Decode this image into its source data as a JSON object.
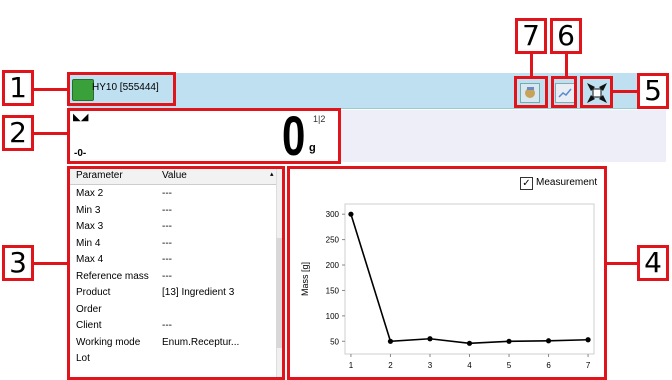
{
  "title_bar": {
    "app_title": "HY10 [555444]"
  },
  "display": {
    "value": "0",
    "unit": "g",
    "stability_marker": "◣◢",
    "zero_marker": "-0-",
    "range_indicator": "1|2"
  },
  "callouts": [
    "1",
    "2",
    "3",
    "4",
    "5",
    "6",
    "7"
  ],
  "table": {
    "headers": [
      "Parameter",
      "Value"
    ],
    "rows": [
      {
        "p": "Max 2",
        "v": "---"
      },
      {
        "p": "Min 3",
        "v": "---"
      },
      {
        "p": "Max 3",
        "v": "---"
      },
      {
        "p": "Min 4",
        "v": "---"
      },
      {
        "p": "Max 4",
        "v": "---"
      },
      {
        "p": "Reference mass",
        "v": "---"
      },
      {
        "p": "Product",
        "v": "[13] Ingredient 3"
      },
      {
        "p": "Order",
        "v": ""
      },
      {
        "p": "Client",
        "v": "---"
      },
      {
        "p": "Working mode",
        "v": "Enum.Receptur..."
      },
      {
        "p": "Lot",
        "v": ""
      }
    ]
  },
  "chart_checkbox": {
    "label": "Measurement",
    "checked": "✓"
  },
  "chart_data": {
    "type": "line",
    "ylabel": "Mass [g]",
    "xlabel": "",
    "x": [
      1,
      2,
      3,
      4,
      5,
      6,
      7
    ],
    "values": [
      300,
      50,
      55,
      46,
      50,
      51,
      53
    ],
    "ylim": [
      25,
      320
    ],
    "yticks": [
      50,
      100,
      150,
      200,
      250,
      300
    ],
    "xticks": [
      1,
      2,
      3,
      4,
      5,
      6,
      7
    ],
    "grid": false,
    "color": "#000000"
  }
}
